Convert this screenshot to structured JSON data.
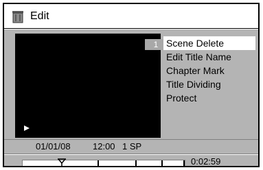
{
  "title": {
    "icon": "trash-bin-icon",
    "text": "Edit"
  },
  "preview": {
    "scene_number": "1",
    "play_icon": "play-icon"
  },
  "menu": {
    "items": [
      {
        "label": "Scene Delete",
        "selected": true
      },
      {
        "label": "Edit Title Name",
        "selected": false
      },
      {
        "label": "Chapter Mark",
        "selected": false
      },
      {
        "label": "Title Dividing",
        "selected": false
      },
      {
        "label": "Protect",
        "selected": false
      }
    ]
  },
  "info": {
    "date": "01/01/08",
    "time": "12:00",
    "mode": "1 SP"
  },
  "timeline": {
    "cursor_icon": "position-cursor-icon",
    "elapsed": "0:02:59"
  },
  "colors": {
    "panel": "#b4b4b4",
    "preview": "#000000",
    "selection": "#ffffff"
  }
}
